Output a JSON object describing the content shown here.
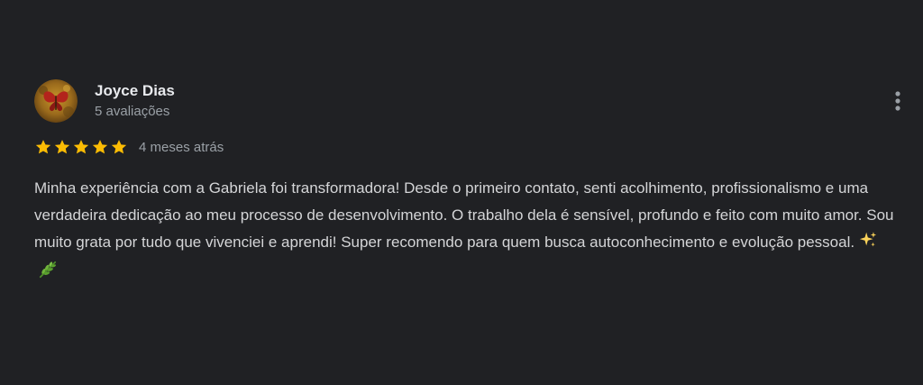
{
  "reviewer": {
    "name": "Joyce Dias",
    "meta": "5 avaliações",
    "avatar_icon": "avatar-butterfly-icon"
  },
  "rating": {
    "stars": 5,
    "max_stars": 5,
    "star_color": "#fbbc04",
    "date": "4 meses atrás"
  },
  "review": {
    "text": "Minha experiência com a Gabriela foi transformadora! Desde o primeiro contato, senti acolhimento, profissionalismo e uma verdadeira dedicação ao meu processo de desenvolvimento. O trabalho dela é sensível, profundo e feito com muito amor. Sou muito grata por tudo que vivenciei e aprendi! Super recomendo para quem busca autoconhecimento e evolução pessoal.",
    "emojis": [
      "sparkles-icon",
      "herb-icon"
    ]
  },
  "colors": {
    "background": "#202124",
    "name": "#e8eaed",
    "secondary": "#9aa0a6",
    "body": "#d4d5d7"
  }
}
